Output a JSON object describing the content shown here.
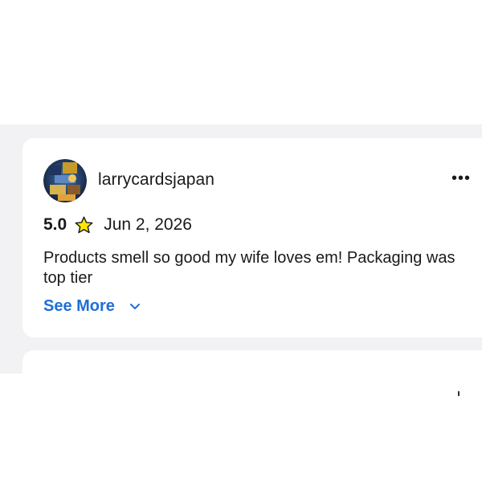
{
  "review": {
    "username": "larrycardsjapan",
    "rating": "5.0",
    "date": "Jun 2, 2026",
    "text": "Products smell so good my wife loves em! Packaging was top tier",
    "see_more_label": "See More",
    "more_icon": "more-horizontal-icon",
    "star_icon": "star-icon",
    "chevron_icon": "chevron-down-icon"
  },
  "colors": {
    "link": "#1f6fd8",
    "star_fill": "#ffe600",
    "text": "#1a1a1a",
    "background_band": "#f2f2f4"
  }
}
